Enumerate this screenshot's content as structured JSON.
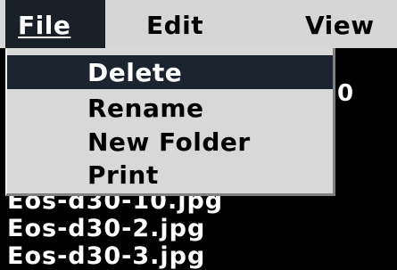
{
  "menubar": {
    "items": [
      {
        "label": "File"
      },
      {
        "label": "Edit"
      },
      {
        "label": "View"
      }
    ]
  },
  "file_menu": {
    "items": [
      {
        "label": "Delete",
        "highlighted": true
      },
      {
        "label": "Rename"
      },
      {
        "label": "New Folder"
      },
      {
        "label": "Print"
      }
    ]
  },
  "background": {
    "partial_text": "0",
    "files": [
      {
        "name": "Eos-d30-10.jpg"
      },
      {
        "name": "Eos-d30-2.jpg"
      },
      {
        "name": "Eos-d30-3.jpg"
      }
    ]
  },
  "colors": {
    "menubar_bg": "#d6d6d6",
    "selection_bg": "#1c2430",
    "window_bg": "#000000"
  }
}
